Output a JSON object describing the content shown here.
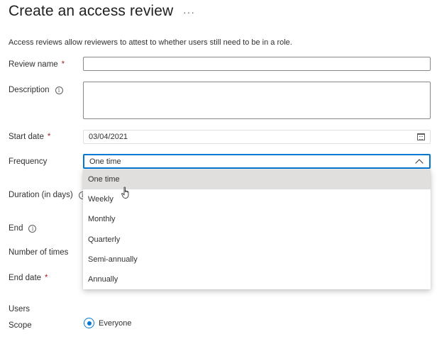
{
  "page": {
    "title": "Create an access review",
    "more_label": "···",
    "intro": "Access reviews allow reviewers to attest to whether users still need to be in a role."
  },
  "form": {
    "review_name_label": "Review name",
    "review_name_value": "",
    "description_label": "Description",
    "description_value": "",
    "start_date_label": "Start date",
    "start_date_value": "03/04/2021",
    "frequency_label": "Frequency",
    "frequency_value": "One time",
    "duration_label": "Duration (in days)",
    "end_label": "End",
    "number_of_times_label": "Number of times",
    "end_date_label": "End date",
    "required_marker": "*",
    "info_glyph": "i"
  },
  "frequency_options": [
    "One time",
    "Weekly",
    "Monthly",
    "Quarterly",
    "Semi-annually",
    "Annually"
  ],
  "users": {
    "section_label": "Users",
    "scope_label": "Scope",
    "scope_value": "Everyone"
  },
  "colors": {
    "accent": "#0078d4",
    "required": "#a4262c",
    "selected_option_bg": "#e1dfdd"
  },
  "icons": {
    "more": "ellipsis-icon",
    "info": "info-icon",
    "calendar": "calendar-icon",
    "chevron": "chevron-up-icon",
    "cursor": "hand-pointer-cursor"
  }
}
